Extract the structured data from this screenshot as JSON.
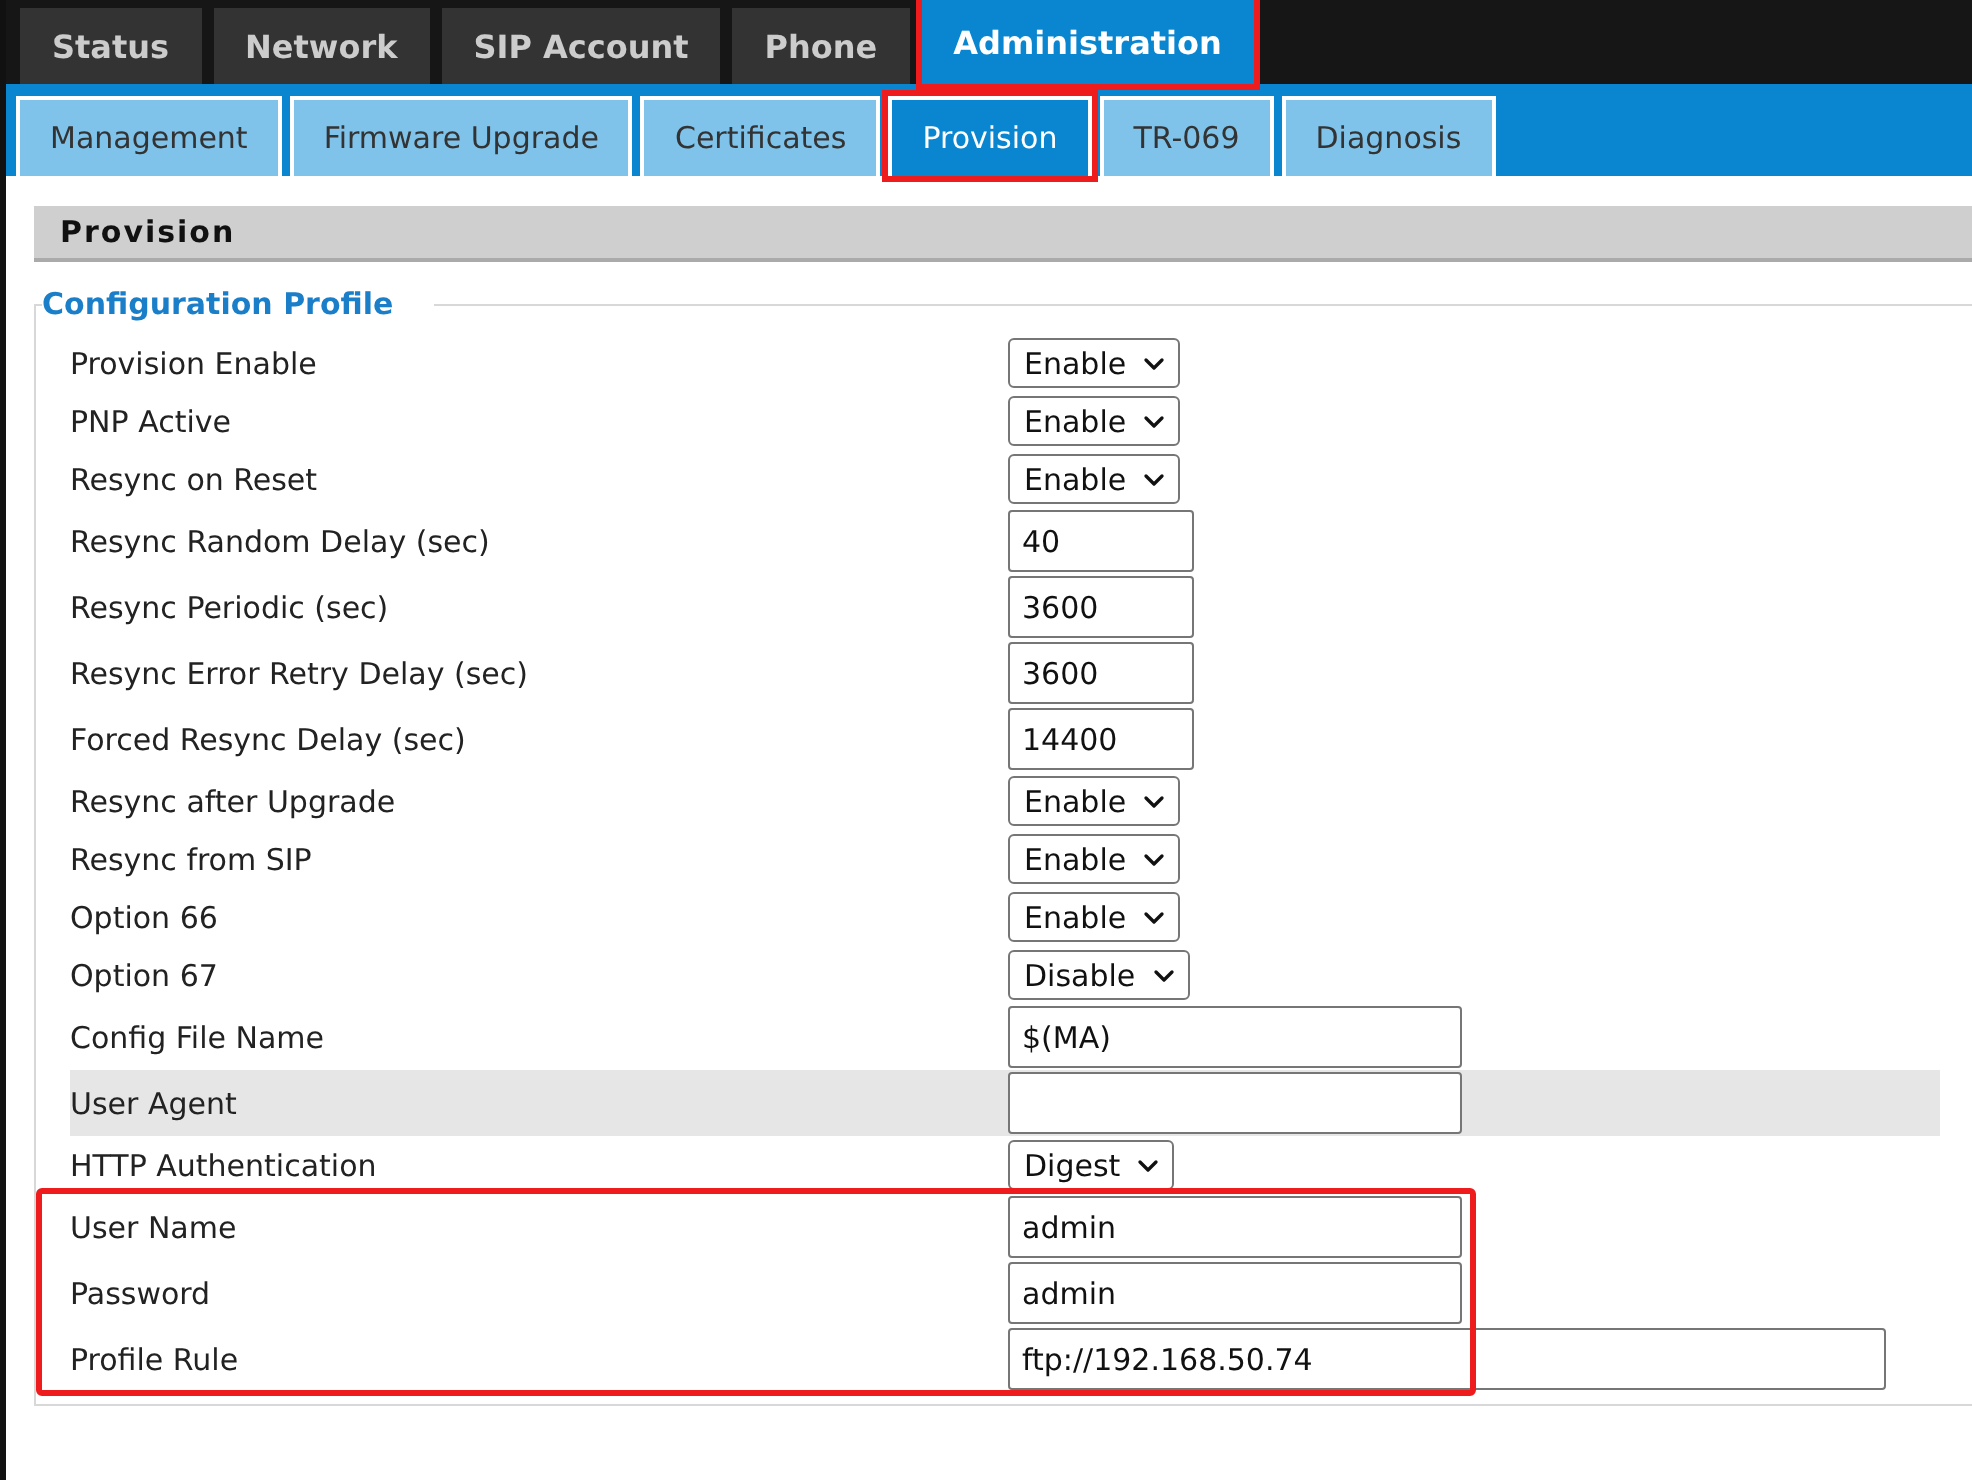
{
  "main_tabs": [
    {
      "label": "Status",
      "selected": false,
      "highlighted": false
    },
    {
      "label": "Network",
      "selected": false,
      "highlighted": false
    },
    {
      "label": "SIP Account",
      "selected": false,
      "highlighted": false
    },
    {
      "label": "Phone",
      "selected": false,
      "highlighted": false
    },
    {
      "label": "Administration",
      "selected": true,
      "highlighted": true
    }
  ],
  "sub_tabs": [
    {
      "label": "Management",
      "selected": false,
      "highlighted": false
    },
    {
      "label": "Firmware Upgrade",
      "selected": false,
      "highlighted": false
    },
    {
      "label": "Certificates",
      "selected": false,
      "highlighted": false
    },
    {
      "label": "Provision",
      "selected": true,
      "highlighted": true
    },
    {
      "label": "TR-069",
      "selected": false,
      "highlighted": false
    },
    {
      "label": "Diagnosis",
      "selected": false,
      "highlighted": false
    }
  ],
  "section_title": "Provision",
  "fieldset": {
    "legend": "Configuration Profile",
    "rows": [
      {
        "label": "Provision Enable",
        "kind": "select",
        "value": "Enable",
        "shaded": false,
        "highlighted": false
      },
      {
        "label": "PNP Active",
        "kind": "select",
        "value": "Enable",
        "shaded": false,
        "highlighted": false
      },
      {
        "label": "Resync on Reset",
        "kind": "select",
        "value": "Enable",
        "shaded": false,
        "highlighted": false
      },
      {
        "label": "Resync Random Delay (sec)",
        "kind": "number",
        "value": "40",
        "shaded": false,
        "highlighted": false
      },
      {
        "label": "Resync Periodic (sec)",
        "kind": "number",
        "value": "3600",
        "shaded": false,
        "highlighted": false
      },
      {
        "label": "Resync Error Retry Delay (sec)",
        "kind": "number",
        "value": "3600",
        "shaded": false,
        "highlighted": false
      },
      {
        "label": "Forced Resync Delay (sec)",
        "kind": "number",
        "value": "14400",
        "shaded": false,
        "highlighted": false
      },
      {
        "label": "Resync after Upgrade",
        "kind": "select",
        "value": "Enable",
        "shaded": false,
        "highlighted": false
      },
      {
        "label": "Resync from SIP",
        "kind": "select",
        "value": "Enable",
        "shaded": false,
        "highlighted": false
      },
      {
        "label": "Option 66",
        "kind": "select",
        "value": "Enable",
        "shaded": false,
        "highlighted": false
      },
      {
        "label": "Option 67",
        "kind": "select",
        "value": "Disable",
        "shaded": false,
        "highlighted": false
      },
      {
        "label": "Config File Name",
        "kind": "text",
        "value": "$(MA)",
        "shaded": false,
        "highlighted": false
      },
      {
        "label": "User Agent",
        "kind": "text",
        "value": "",
        "shaded": true,
        "highlighted": false
      },
      {
        "label": "HTTP Authentication",
        "kind": "select",
        "value": "Digest",
        "shaded": false,
        "highlighted": false
      },
      {
        "label": "User Name",
        "kind": "text",
        "value": "admin",
        "shaded": false,
        "highlighted": true
      },
      {
        "label": "Password",
        "kind": "text",
        "value": "admin",
        "shaded": false,
        "highlighted": true
      },
      {
        "label": "Profile Rule",
        "kind": "url",
        "value": "ftp://192.168.50.74",
        "shaded": false,
        "highlighted": true
      }
    ]
  }
}
